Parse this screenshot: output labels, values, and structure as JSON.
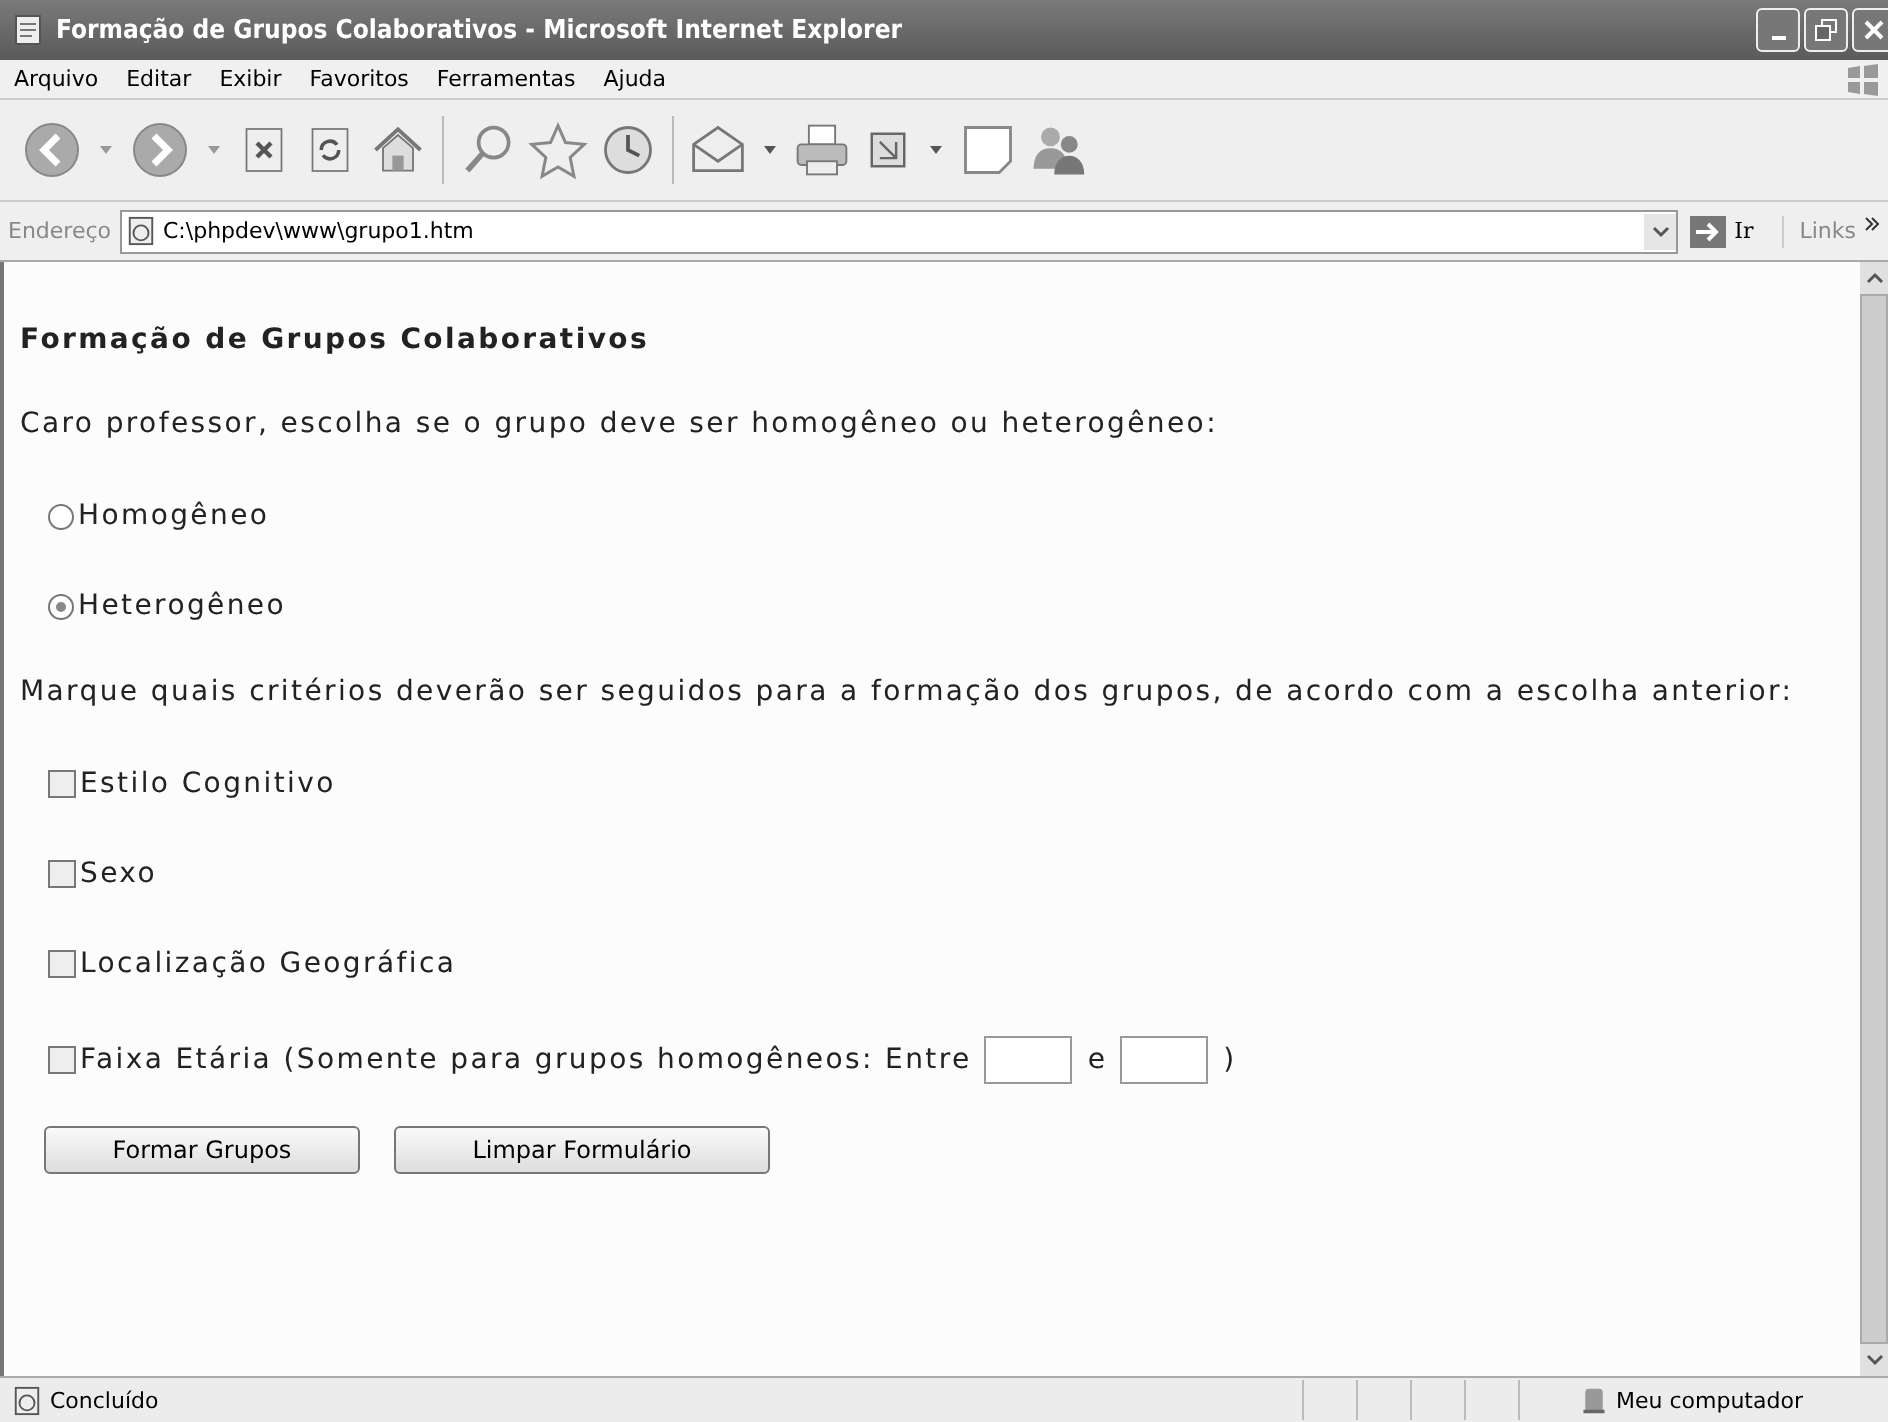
{
  "window": {
    "title": "Formação de Grupos Colaborativos - Microsoft Internet Explorer"
  },
  "menu": [
    "Arquivo",
    "Editar",
    "Exibir",
    "Favoritos",
    "Ferramentas",
    "Ajuda"
  ],
  "address_bar": {
    "label": "Endereço",
    "value": "C:\\phpdev\\www\\grupo1.htm",
    "go": "Ir",
    "links": "Links"
  },
  "page": {
    "heading": "Formação de Grupos Colaborativos",
    "intro": "Caro professor, escolha se o grupo deve ser homogêneo ou heterogêneo:",
    "radios": [
      {
        "label": "Homogêneo",
        "selected": false
      },
      {
        "label": "Heterogêneo",
        "selected": true
      }
    ],
    "criteria_prompt": "Marque quais critérios deverão ser seguidos para a formação dos grupos, de acordo com a escolha anterior:",
    "criteria": [
      {
        "kind": "plain",
        "label": "Estilo Cognitivo",
        "checked": false
      },
      {
        "kind": "plain",
        "label": "Sexo",
        "checked": false
      },
      {
        "kind": "plain",
        "label": "Localização Geográfica",
        "checked": false
      },
      {
        "kind": "range",
        "label": "Faixa Etária (Somente para grupos homogêneos: Entre",
        "separator": "e",
        "closing": ")",
        "checked": false
      }
    ],
    "buttons": [
      "Formar Grupos",
      "Limpar Formulário"
    ]
  },
  "status_bar": {
    "message": "Concluído",
    "zone": "Meu computador"
  }
}
